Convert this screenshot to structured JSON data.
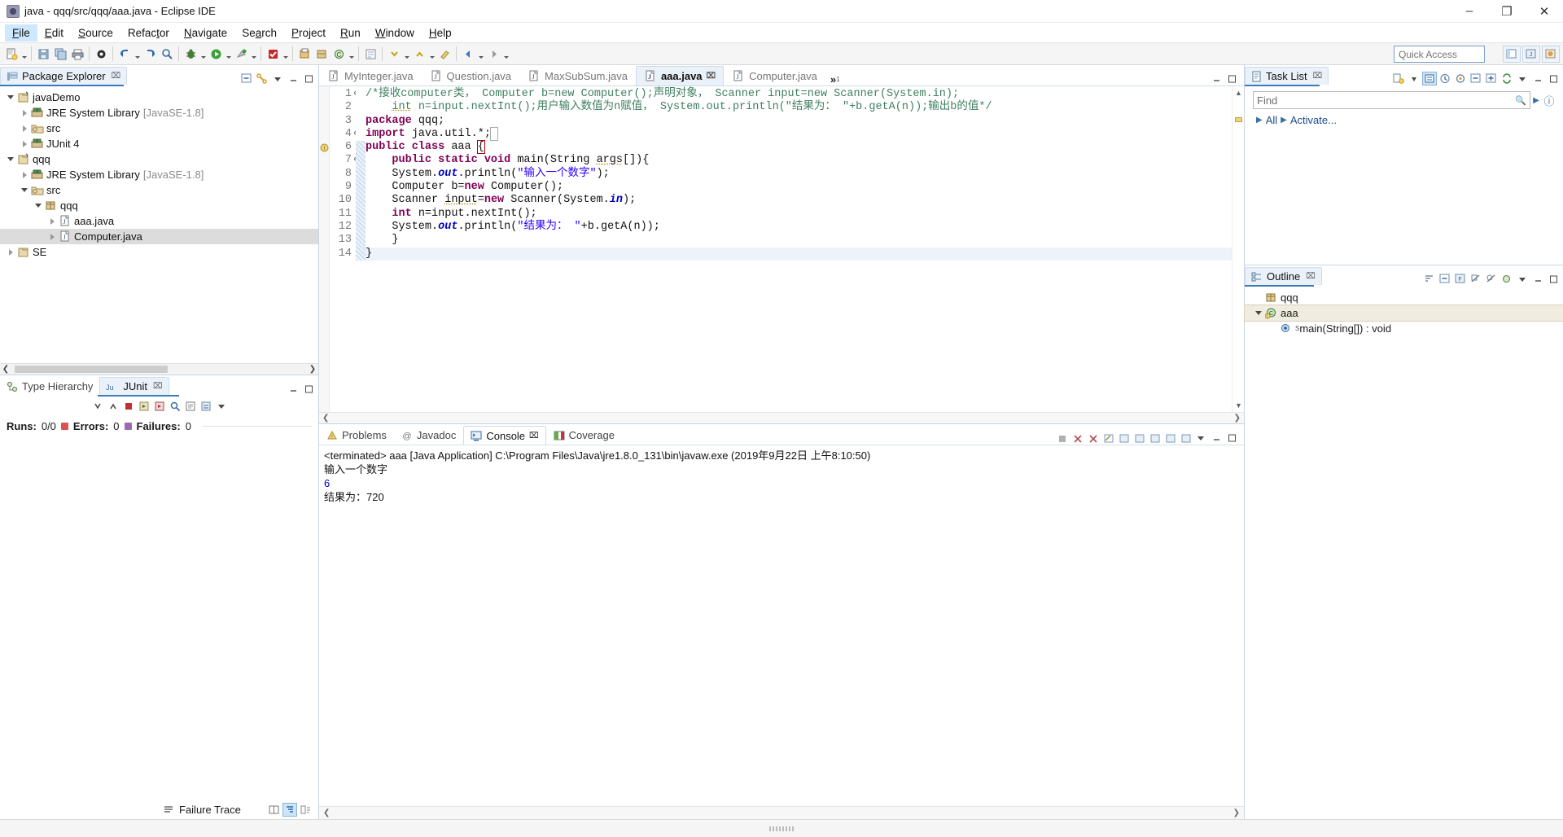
{
  "window": {
    "title": "java - qqq/src/qqq/aaa.java - Eclipse IDE",
    "app_icon": "eclipse-icon",
    "minimize": "–",
    "maximize": "❐",
    "close": "✕"
  },
  "menubar": {
    "items": [
      {
        "label": "File",
        "mnemonic": "F",
        "active": true
      },
      {
        "label": "Edit",
        "mnemonic": "E",
        "active": false
      },
      {
        "label": "Source",
        "mnemonic": "S",
        "active": false
      },
      {
        "label": "Refactor",
        "mnemonic": "t",
        "active": false
      },
      {
        "label": "Navigate",
        "mnemonic": "N",
        "active": false
      },
      {
        "label": "Search",
        "mnemonic": "a",
        "active": false
      },
      {
        "label": "Project",
        "mnemonic": "P",
        "active": false
      },
      {
        "label": "Run",
        "mnemonic": "R",
        "active": false
      },
      {
        "label": "Window",
        "mnemonic": "W",
        "active": false
      },
      {
        "label": "Help",
        "mnemonic": "H",
        "active": false
      }
    ]
  },
  "toolbar": {
    "quick_access_placeholder": "Quick Access",
    "quick_access_value": "",
    "buttons": [
      "new-wizard-icon",
      "save-icon",
      "save-all-icon",
      "print-icon",
      "build-icon",
      "undo-icon",
      "redo-icon",
      "debug-icon",
      "run-icon",
      "run-external-tools-icon",
      "new-java-project-icon",
      "new-class-icon",
      "search-icon",
      "open-type-icon",
      "next-annotation-icon",
      "previous-annotation-icon",
      "last-edit-location-icon",
      "back-icon",
      "forward-icon",
      "pin-editor-icon"
    ],
    "perspective_buttons": [
      "open-perspective-icon",
      "java-perspective-icon",
      "java-ee-perspective-icon"
    ]
  },
  "package_explorer": {
    "title": "Package Explorer",
    "close_glyph": "⌧",
    "actions": [
      "collapse-all-icon",
      "link-with-editor-icon",
      "view-menu-icon",
      "minimize-icon",
      "maximize-icon"
    ],
    "tree": [
      {
        "label": "javaDemo",
        "indent": 0,
        "twisty": "down",
        "icon": "java-project-icon",
        "suffix": "",
        "selected": false
      },
      {
        "label": "JRE System Library",
        "indent": 1,
        "twisty": "right",
        "icon": "library-icon",
        "suffix": "[JavaSE-1.8]",
        "selected": false
      },
      {
        "label": "src",
        "indent": 1,
        "twisty": "right",
        "icon": "source-folder-icon",
        "suffix": "",
        "selected": false
      },
      {
        "label": "JUnit 4",
        "indent": 1,
        "twisty": "right",
        "icon": "library-icon",
        "suffix": "",
        "selected": false
      },
      {
        "label": "qqq",
        "indent": 0,
        "twisty": "down",
        "icon": "java-project-icon",
        "suffix": "",
        "selected": false
      },
      {
        "label": "JRE System Library",
        "indent": 1,
        "twisty": "right",
        "icon": "library-icon",
        "suffix": "[JavaSE-1.8]",
        "selected": false
      },
      {
        "label": "src",
        "indent": 1,
        "twisty": "down",
        "icon": "source-folder-icon",
        "suffix": "",
        "selected": false
      },
      {
        "label": "qqq",
        "indent": 2,
        "twisty": "down",
        "icon": "package-icon",
        "suffix": "",
        "selected": false
      },
      {
        "label": "aaa.java",
        "indent": 3,
        "twisty": "right",
        "icon": "java-file-icon",
        "suffix": "",
        "selected": false
      },
      {
        "label": "Computer.java",
        "indent": 3,
        "twisty": "right",
        "icon": "java-file-icon",
        "suffix": "",
        "selected": true
      },
      {
        "label": "SE",
        "indent": 0,
        "twisty": "right",
        "icon": "project-icon",
        "suffix": "",
        "selected": false
      }
    ]
  },
  "bottom_left": {
    "tabs": [
      {
        "label": "Type Hierarchy",
        "icon": "type-hierarchy-icon",
        "active": false,
        "close": ""
      },
      {
        "label": "JUnit",
        "icon": "junit-icon",
        "active": true,
        "close": "⌧"
      }
    ],
    "junit": {
      "runs_label": "Runs:",
      "runs_value": "0/0",
      "errors_label": "Errors:",
      "errors_value": "0",
      "failures_label": "Failures:",
      "failures_value": "0",
      "failure_trace_label": "Failure Trace",
      "toolbar_icons": [
        "next-failure-icon",
        "previous-failure-icon",
        "stop-icon",
        "rerun-test-icon",
        "rerun-failed-icon",
        "search-icon",
        "history-icon",
        "scroll-lock-icon",
        "view-menu-icon"
      ]
    }
  },
  "editor": {
    "tabs": [
      {
        "label": "MyInteger.java",
        "active": false,
        "close": ""
      },
      {
        "label": "Question.java",
        "active": false,
        "close": ""
      },
      {
        "label": "MaxSubSum.java",
        "active": false,
        "close": ""
      },
      {
        "label": "aaa.java",
        "active": true,
        "close": "⌧"
      },
      {
        "label": "Computer.java",
        "active": false,
        "close": ""
      }
    ],
    "overflow_label": "»",
    "overflow_count": "1",
    "minimize": "—",
    "maximize": "❐",
    "lines": [
      {
        "num": "1",
        "fold": "⊖",
        "marker": "",
        "html": "<span class='cm'>/*接收computer类， Computer b=new Computer();声明对象， Scanner input=new Scanner(System.in);</span>",
        "plain": "/*接收computer类， Computer b=new Computer();声明对象， Scanner input=new Scanner(System.in);"
      },
      {
        "num": "2",
        "fold": "",
        "marker": "",
        "html": "    <span class='cm stat'>int</span><span class='cm'> n=input.nextInt();用户输入数值为n赋值， System.out.println(\"结果为： \"+b.getA(n));输出b的值*/</span>",
        "plain": "    int n=input.nextInt();用户输入数值为n赋值， System.out.println(\"结果为： \"+b.getA(n));输出b的值*/"
      },
      {
        "num": "3",
        "fold": "",
        "marker": "",
        "html": "<span class='k'>package</span> qqq;",
        "plain": "package qqq;"
      },
      {
        "num": "4",
        "fold": "⊕",
        "marker": "",
        "html": "<span class='k'>import</span> java.util.*;<span style='outline:1px solid #aaa;color:#aaa'> </span>",
        "plain": "import java.util.*;"
      },
      {
        "num": "6",
        "fold": "",
        "marker": "changed",
        "html": "<span class='k'>public class</span> aaa <span class='brk'>{</span>",
        "plain": "public class aaa {"
      },
      {
        "num": "7",
        "fold": "⊖",
        "marker": "changed",
        "html": "    <span class='k'>public static void</span> main(String <span class='stat'>args</span>[]){",
        "plain": "    public static void main(String args[]){"
      },
      {
        "num": "8",
        "fold": "",
        "marker": "changed",
        "html": "    System.<span class='fld'>out</span>.println(<span class='s'>\"输入一个数字\"</span>);",
        "plain": "    System.out.println(\"输入一个数字\");"
      },
      {
        "num": "9",
        "fold": "",
        "marker": "changed",
        "html": "    Computer b=<span class='k'>new</span> Computer();",
        "plain": "    Computer b=new Computer();"
      },
      {
        "num": "10",
        "fold": "",
        "marker": "warning",
        "html": "    Scanner <span class='stat'>input</span>=<span class='k'>new</span> Scanner(System.<span class='fld'>in</span>);",
        "plain": "    Scanner input=new Scanner(System.in);"
      },
      {
        "num": "11",
        "fold": "",
        "marker": "changed",
        "html": "    <span class='k'>int</span> n=input.nextInt();",
        "plain": "    int n=input.nextInt();"
      },
      {
        "num": "12",
        "fold": "",
        "marker": "changed",
        "html": "    System.<span class='fld'>out</span>.println(<span class='s'>\"结果为： \"</span>+b.getA(n));",
        "plain": "    System.out.println(\"结果为： \"+b.getA(n));"
      },
      {
        "num": "13",
        "fold": "",
        "marker": "changed",
        "html": "    }",
        "plain": "    }"
      },
      {
        "num": "14",
        "fold": "",
        "marker": "changed",
        "html": "}",
        "plain": "}",
        "highlight": true
      }
    ]
  },
  "console_panel": {
    "tabs": [
      {
        "label": "Problems",
        "icon": "problems-icon",
        "active": false,
        "close": ""
      },
      {
        "label": "Javadoc",
        "icon": "javadoc-icon",
        "active": false,
        "close": ""
      },
      {
        "label": "Console",
        "icon": "console-icon",
        "active": true,
        "close": "⌧"
      },
      {
        "label": "Coverage",
        "icon": "coverage-icon",
        "active": false,
        "close": ""
      }
    ],
    "actions": [
      "terminate-icon",
      "remove-launch-icon",
      "remove-all-icon",
      "clear-console-icon",
      "scroll-lock-icon",
      "word-wrap-icon",
      "pin-console-icon",
      "display-selected-icon",
      "open-console-icon",
      "view-menu-icon",
      "minimize-icon",
      "maximize-icon"
    ],
    "header": "<terminated> aaa [Java Application] C:\\Program Files\\Java\\jre1.8.0_131\\bin\\javaw.exe (2019年9月22日 上午8:10:50)",
    "output": [
      {
        "text": "输入一个数字",
        "color": "black"
      },
      {
        "text": "6",
        "color": "blue"
      },
      {
        "text": "结果为：720",
        "color": "black"
      }
    ]
  },
  "task_list": {
    "title": "Task List",
    "close_glyph": "⌧",
    "find_placeholder": "Find",
    "find_value": "",
    "all_label": "All",
    "activate_label": "Activate...",
    "actions": [
      "new-task-icon",
      "view-menu-caret-icon",
      "categorize-icon",
      "schedule-icon",
      "focus-icon",
      "collapse-all-icon",
      "expand-all-icon",
      "synchronize-icon",
      "view-menu-icon",
      "minimize-icon",
      "maximize-icon"
    ]
  },
  "outline": {
    "title": "Outline",
    "close_glyph": "⌧",
    "actions": [
      "sort-icon",
      "collapse-all-icon",
      "hide-fields-icon",
      "hide-static-icon",
      "hide-nonpublic-icon",
      "hide-local-types-icon",
      "view-menu-icon",
      "minimize-icon",
      "maximize-icon"
    ],
    "items": [
      {
        "label": "qqq",
        "icon": "package-icon",
        "indent": 0,
        "twisty": "",
        "selected": false,
        "sup": ""
      },
      {
        "label": "aaa",
        "icon": "class-icon",
        "indent": 0,
        "twisty": "down",
        "selected": true,
        "sup": ""
      },
      {
        "label": "main(String[]) : void",
        "icon": "method-public-static-icon",
        "indent": 1,
        "twisty": "",
        "selected": false,
        "sup": "S"
      }
    ]
  },
  "colors": {
    "accent": "#3d7ab8",
    "tab_active_bg": "#eaf1f9",
    "selection_bg": "#dcdcdc",
    "keyword": "#7f0055",
    "string": "#2a00ff",
    "comment": "#3f7f5f",
    "field": "#0000c0"
  }
}
